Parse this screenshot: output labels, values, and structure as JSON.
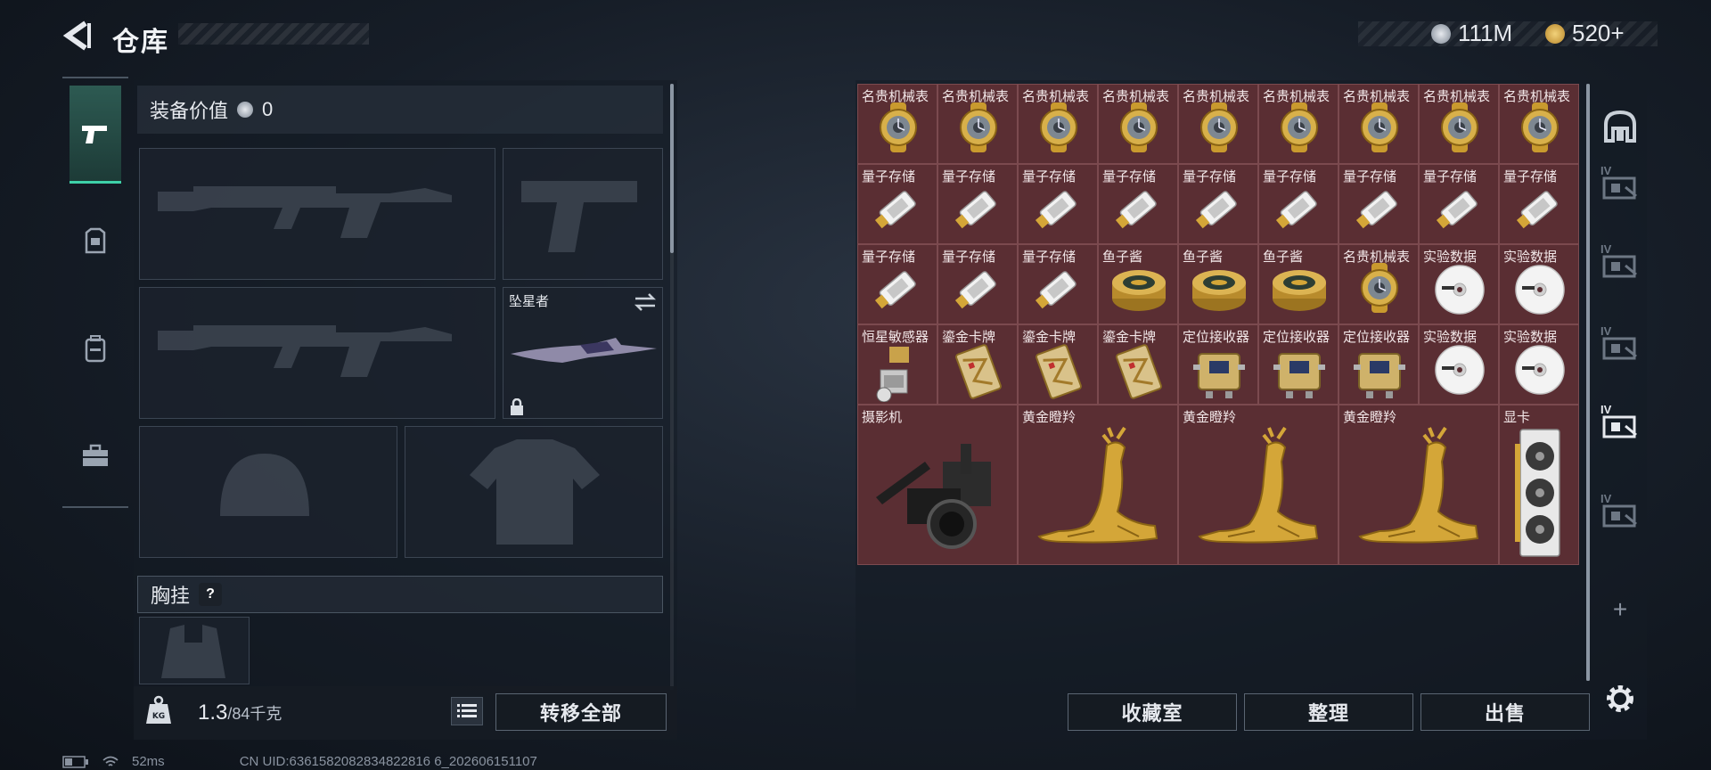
{
  "header": {
    "title": "仓库",
    "currency1": "111M",
    "currency2": "520+"
  },
  "left_nav": {
    "tabs": [
      {
        "icon": "pistol-icon",
        "active": true
      },
      {
        "icon": "armor-icon",
        "active": false
      },
      {
        "icon": "backpack-icon",
        "active": false
      },
      {
        "icon": "toolbox-icon",
        "active": false
      }
    ]
  },
  "equipment": {
    "value_label": "装备价值",
    "value": "0",
    "melee_name": "坠星者",
    "chest_label": "胸挂",
    "help": "?"
  },
  "weight": {
    "current": "1.3",
    "max": "/84千克"
  },
  "buttons": {
    "transfer_all": "转移全部",
    "collection": "收藏室",
    "sort": "整理",
    "sell": "出售"
  },
  "inventory": {
    "row1": [
      "名贵机械表",
      "名贵机械表",
      "名贵机械表",
      "名贵机械表",
      "名贵机械表",
      "名贵机械表",
      "名贵机械表",
      "名贵机械表",
      "名贵机械表"
    ],
    "row2": [
      "量子存储",
      "量子存储",
      "量子存储",
      "量子存储",
      "量子存储",
      "量子存储",
      "量子存储",
      "量子存储",
      "量子存储"
    ],
    "row3": [
      "量子存储",
      "量子存储",
      "量子存储",
      "鱼子酱",
      "鱼子酱",
      "鱼子酱",
      "名贵机械表",
      "实验数据",
      "实验数据"
    ],
    "row4": [
      "恒星敏感器",
      "鎏金卡牌",
      "鎏金卡牌",
      "鎏金卡牌",
      "定位接收器",
      "定位接收器",
      "定位接收器",
      "实验数据",
      "实验数据"
    ],
    "big": [
      "摄影机",
      "黄金瞪羚",
      "黄金瞪羚",
      "黄金瞪羚",
      "显卡"
    ]
  },
  "side_tabs": [
    {
      "icon": "vault-icon"
    },
    {
      "label": "IV",
      "icon": "case-icon"
    },
    {
      "label": "IV",
      "icon": "case-icon"
    },
    {
      "label": "IV",
      "icon": "case-icon"
    },
    {
      "label": "IV",
      "icon": "case-icon",
      "active": true
    },
    {
      "label": "IV",
      "icon": "case-icon"
    },
    {
      "icon": "plus-icon",
      "text": "+"
    }
  ],
  "status": {
    "ping": "52ms",
    "uid": "CN UID:6361582082834822816 6_202606151107"
  },
  "colors": {
    "accent": "#3ed1a8",
    "item_bg": "#5a2e33",
    "gold": "#d4a638"
  }
}
